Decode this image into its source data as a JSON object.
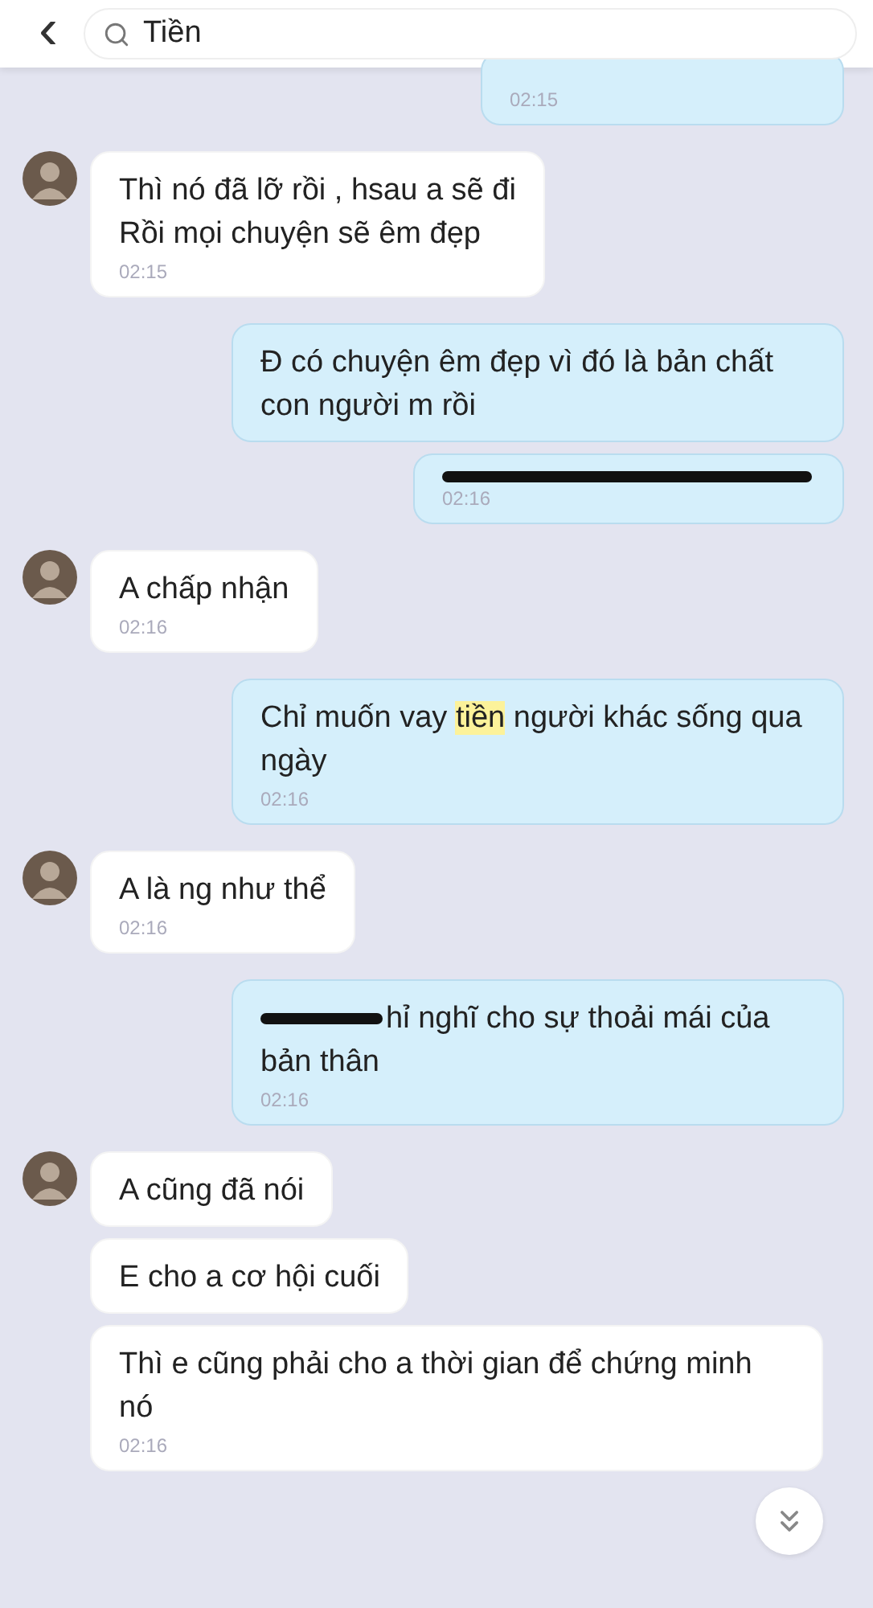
{
  "header": {
    "back": "‹",
    "search": {
      "value": "Tiền"
    }
  },
  "messages": [
    {
      "kind": "sent",
      "avatar": false,
      "time": "02:15"
    },
    {
      "kind": "received",
      "avatar": true,
      "text": "Thì nó đã lỡ rồi , hsau a sẽ đi\nRồi mọi chuyện sẽ êm đẹp",
      "time": "02:15"
    },
    {
      "kind": "sent",
      "avatar": false,
      "text": "Đ có chuyện êm đẹp vì đó là bản chất con người m rồi"
    },
    {
      "kind": "sent",
      "avatar": false,
      "parts": [
        {
          "kind": "scribble"
        }
      ],
      "time": "02:16"
    },
    {
      "kind": "received",
      "avatar": true,
      "text": "A chấp nhận",
      "time": "02:16"
    },
    {
      "kind": "sent",
      "avatar": false,
      "parts": [
        {
          "kind": "text",
          "text": "Chỉ muốn vay "
        },
        {
          "kind": "highlight",
          "text": "tiền"
        },
        {
          "kind": "text",
          "text": " người khác sống qua ngày"
        }
      ],
      "time": "02:16"
    },
    {
      "kind": "received",
      "avatar": true,
      "text": "A là ng như thể",
      "time": "02:16"
    },
    {
      "kind": "sent",
      "avatar": false,
      "parts": [
        {
          "kind": "scribble"
        },
        {
          "kind": "text",
          "text": "hỉ nghĩ cho sự thoải mái của bản thân"
        }
      ],
      "time": "02:16"
    },
    {
      "kind": "received",
      "avatar": true,
      "text": "A cũng đã nói"
    },
    {
      "kind": "received",
      "avatar": false,
      "text": "E cho a cơ hội cuối"
    },
    {
      "kind": "received",
      "avatar": false,
      "text": "Thì e cũng phải cho a thời gian để chứng minh nó",
      "time": "02:16"
    }
  ]
}
